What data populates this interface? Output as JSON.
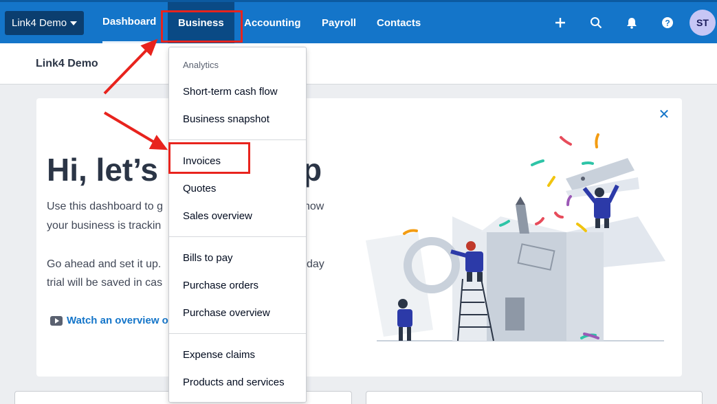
{
  "topbar": {
    "org_switcher": "Link4 Demo",
    "nav": [
      "Dashboard",
      "Business",
      "Accounting",
      "Payroll",
      "Contacts"
    ],
    "avatar_initials": "ST",
    "accent": "#1475c9"
  },
  "org_header": {
    "name": "Link4 Demo"
  },
  "welcome": {
    "title_start": "Hi, let’s",
    "title_end": "p",
    "line1": "Use this dashboard to g",
    "line1_end": "how",
    "line2": "your business is trackin",
    "line3": "Go ahead and set it up.",
    "line3_end": "day",
    "line4": "trial will be saved in cas",
    "watch_link": "Watch an overview o"
  },
  "menu": {
    "section_label": "Analytics",
    "group1": [
      "Short-term cash flow",
      "Business snapshot"
    ],
    "group2": [
      "Invoices",
      "Quotes",
      "Sales overview"
    ],
    "group3": [
      "Bills to pay",
      "Purchase orders",
      "Purchase overview"
    ],
    "group4": [
      "Expense claims",
      "Products and services"
    ]
  },
  "annotation_color": "#e8231d"
}
